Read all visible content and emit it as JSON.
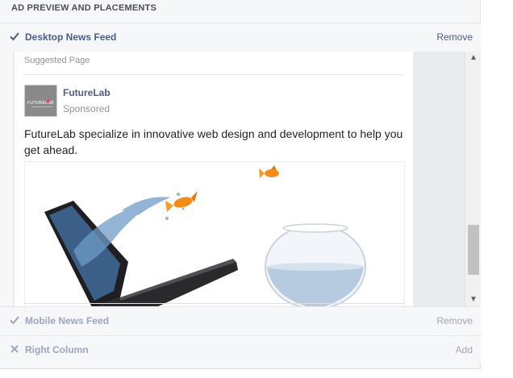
{
  "section": {
    "title": "AD PREVIEW AND PLACEMENTS"
  },
  "placements": {
    "desktop": {
      "label": "Desktop News Feed",
      "action": "Remove",
      "selected": true
    },
    "mobile": {
      "label": "Mobile News Feed",
      "action": "Remove",
      "selected": true
    },
    "right_column": {
      "label": "Right Column",
      "action": "Add",
      "selected": false
    }
  },
  "post": {
    "suggested_label": "Suggested Page",
    "page_name": "FutureLab",
    "sponsored_label": "Sponsored",
    "body_text": "FutureLab specialize in innovative web design and development to help you get ahead.",
    "logo_text": "FUTURELAB"
  },
  "scroll": {
    "up_icon": "chevron-up",
    "down_icon": "chevron-down"
  },
  "colors": {
    "link": "#4b5d84",
    "muted": "#90949c",
    "panel_bg": "#f6f7f9"
  }
}
